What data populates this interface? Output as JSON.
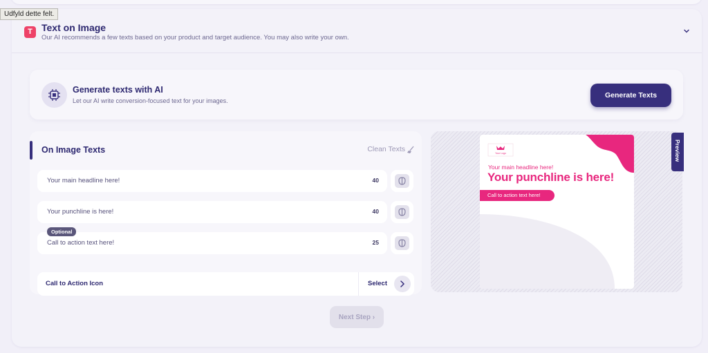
{
  "tooltip": "Udfyld dette felt.",
  "section": {
    "icon_letter": "T",
    "title": "Text on Image",
    "subtitle": "Our AI recommends a few texts based on your product and target audience. You may also write your own."
  },
  "generate": {
    "title": "Generate texts with AI",
    "subtitle": "Let our AI write conversion-focused text for your images.",
    "button": "Generate Texts"
  },
  "texts_panel": {
    "title": "On Image Texts",
    "clean_label": "Clean Texts",
    "fields": [
      {
        "placeholder": "Your main headline here!",
        "count": "40"
      },
      {
        "placeholder": "Your punchline is here!",
        "count": "40"
      },
      {
        "placeholder": "Call to action text here!",
        "count": "25",
        "badge": "Optional"
      }
    ],
    "cta_icon": {
      "label": "Call to Action Icon",
      "select_label": "Select"
    }
  },
  "preview": {
    "tab_label": "Preview",
    "logo_text": "Your Logo",
    "headline": "Your main headline here!",
    "punchline": "Your punchline is here!",
    "cta": "Call to action text here!",
    "colors": {
      "accent": "#e8277e",
      "primary": "#372f7d"
    }
  },
  "footer": {
    "next_label": "Next Step ›"
  }
}
